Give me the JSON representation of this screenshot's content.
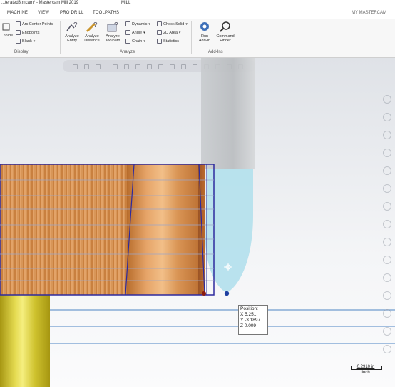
{
  "window": {
    "title": "...terated3.mcam* - Mastercam Mill 2019",
    "product_tab": "MILL"
  },
  "tabs": [
    "MACHINE",
    "VIEW",
    "PRO DRILL",
    "TOOLPATHS"
  ],
  "account_label": "MY MASTERCAM",
  "ribbon": {
    "display": {
      "partial_big_label": "...nhide",
      "items": [
        "Arc Center Points",
        "Endpoints",
        "Blank"
      ],
      "group_label": "Display"
    },
    "analyze": {
      "big_buttons": [
        {
          "line1": "Analyze",
          "line2": "Entity",
          "icon": "analyze-entity-icon"
        },
        {
          "line1": "Analyze",
          "line2": "Distance",
          "icon": "analyze-distance-icon"
        },
        {
          "line1": "Analyze",
          "line2": "Toolpath",
          "icon": "analyze-toolpath-icon"
        }
      ],
      "mid_items": [
        "Dynamic",
        "Angle",
        "Chain"
      ],
      "right_items": [
        "Check Solid",
        "2D Area",
        "Statistics"
      ],
      "group_label": "Analyze"
    },
    "addins": {
      "buttons": [
        {
          "line1": "Run",
          "line2": "Add-In",
          "icon": "run-addin-icon"
        },
        {
          "line1": "Command",
          "line2": "Finder",
          "icon": "command-finder-icon"
        }
      ],
      "group_label": "Add-Ins"
    }
  },
  "position_readout": {
    "title": "Position:",
    "x": "X 5.251",
    "y": "Y -3.1897",
    "z": "Z 0.009"
  },
  "scale": {
    "value": "0.2910 in",
    "unit": "Inch"
  },
  "colors": {
    "part_copper": "#d38c4f",
    "tool_blue": "#b3e0ec",
    "wireframe": "#2e2a9e",
    "stock_yellow": "#e0d44a",
    "endpoint_dot": "#1e3fa0",
    "start_dot": "#8a1a10"
  }
}
